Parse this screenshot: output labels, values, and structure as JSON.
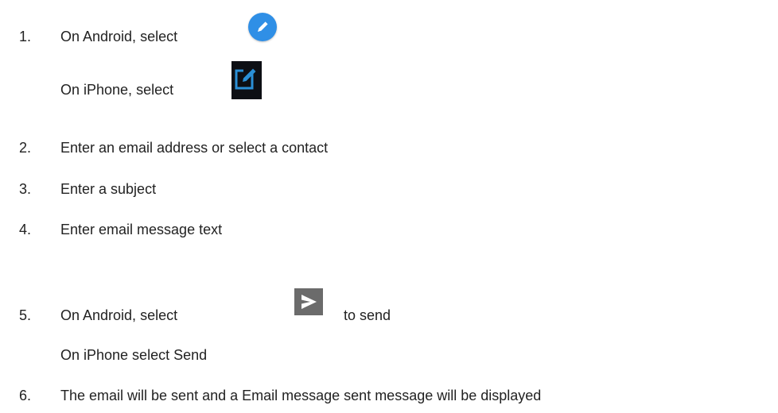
{
  "steps": [
    {
      "num": "1.",
      "line1": "On Android, select",
      "line2": "On iPhone, select"
    },
    {
      "num": "2.",
      "text": "Enter an email address or select a contact"
    },
    {
      "num": "3.",
      "text": "Enter a subject"
    },
    {
      "num": "4.",
      "text": "Enter email message text"
    },
    {
      "num": "5.",
      "line1_a": "On Android, select",
      "line1_b": "to send",
      "line2": "On iPhone select Send"
    },
    {
      "num": "6.",
      "text": "The email will be sent and a Email message sent message will be displayed"
    }
  ],
  "icons": {
    "android_compose": "pencil-circle-icon",
    "iphone_compose": "edit-square-icon",
    "android_send": "send-arrow-icon"
  },
  "colors": {
    "android_compose_bg": "#2f8fe6",
    "iphone_compose_bg": "#0d0f14",
    "iphone_compose_accent": "#2a8fd6",
    "send_bg": "#6b6b6b"
  }
}
